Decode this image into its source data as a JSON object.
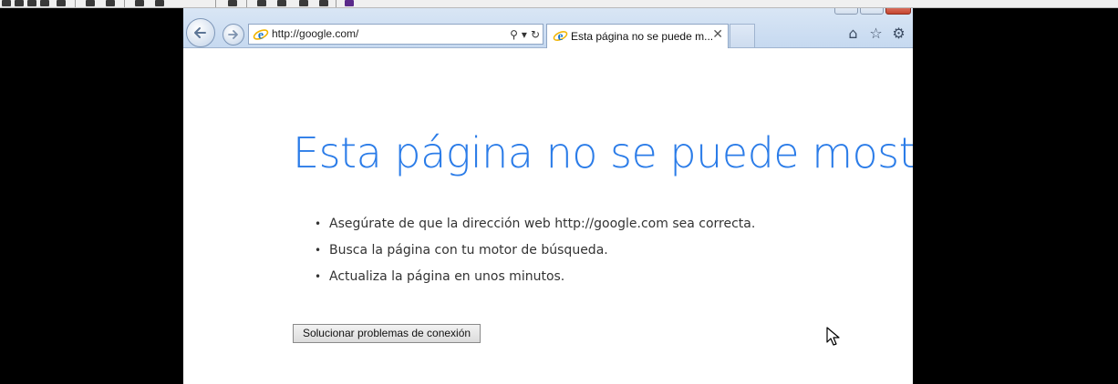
{
  "browser": {
    "address_url": "http://google.com/",
    "tab_title": "Esta página no se puede m...",
    "tab_close_glyph": "✕",
    "icons": [
      "back-icon",
      "forward-icon",
      "search-icon",
      "refresh-icon",
      "home-icon",
      "favorites-icon",
      "settings-icon"
    ]
  },
  "page": {
    "heading": "Esta página no se puede mostra",
    "suggestions": [
      "Asegúrate de que la dirección web http://google.com sea correcta.",
      "Busca la página con tu motor de búsqueda.",
      "Actualiza la página en unos minutos."
    ],
    "fix_button_label": "Solucionar problemas de conexión"
  },
  "colors": {
    "heading_blue": "#2b7ce8",
    "chrome_blue": "#c6d9f0",
    "close_red": "#c4452f"
  }
}
